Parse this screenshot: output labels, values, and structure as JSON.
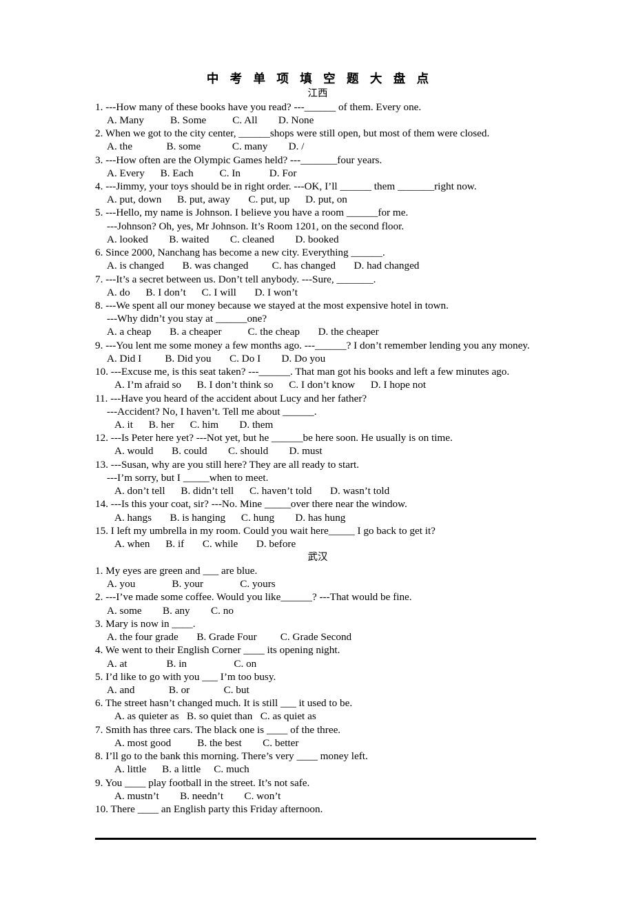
{
  "document": {
    "title": "中 考 单 项 填 空 题 大 盘 点",
    "sections": [
      {
        "name": "江西",
        "questions": [
          {
            "lines": [
              "1. ---How many of these books have you read?    ---______ of them. Every one."
            ],
            "options": "A. Many          B. Some          C. All        D. None",
            "indent": "normal"
          },
          {
            "lines": [
              "2. When we got to the city center, ______shops were still open, but most of them were closed."
            ],
            "options": "A. the             B. some            C. many        D. /",
            "indent": "normal"
          },
          {
            "lines": [
              "3. ---How often are the Olympic Games held?      ---_______four years."
            ],
            "options": "A. Every      B. Each          C. In           D. For",
            "indent": "normal"
          },
          {
            "lines": [
              "4. ---Jimmy, your toys should be in right order.     ---OK, I’ll ______ them _______right now."
            ],
            "options": "A. put, down      B. put, away       C. put, up      D. put, on",
            "indent": "normal"
          },
          {
            "lines": [
              "5. ---Hello, my name is Johnson. I believe you have a room ______for me."
            ],
            "sub": "---Johnson? Oh, yes, Mr Johnson. It’s Room 1201, on the second floor.",
            "options": "A. looked        B. waited        C. cleaned        D. booked",
            "indent": "normal"
          },
          {
            "lines": [
              "6. Since 2000, Nanchang has become a new city. Everything ______."
            ],
            "options": "A. is changed       B. was changed         C. has changed       D. had changed",
            "indent": "normal"
          },
          {
            "lines": [
              "7. ---It’s a secret between us. Don’t tell anybody.       ---Sure, _______."
            ],
            "options": "A. do      B. I don’t      C. I will       D. I won’t",
            "indent": "normal"
          },
          {
            "lines": [
              "8. ---We spent all our money because we stayed at the most expensive hotel in town."
            ],
            "sub": "---Why didn’t you stay at ______one?",
            "options": "A. a cheap       B. a cheaper          C. the cheap       D. the cheaper",
            "indent": "normal"
          },
          {
            "lines": [
              "9. ---You lent me some money a few months ago.   ---______? I don’t remember lending you any money."
            ],
            "options": "A. Did I         B. Did you       C. Do I        D. Do you",
            "indent": "normal"
          },
          {
            "lines": [
              "10. ---Excuse me, is this seat taken?    ---______. That man got his books and left a few minutes ago."
            ],
            "options": "A. I’m afraid so      B. I don’t think so      C. I don’t know      D. I hope not",
            "indent": "deep"
          },
          {
            "lines": [
              "11. ---Have you heard of the accident about Lucy and her father?"
            ],
            "sub": "---Accident? No, I haven’t. Tell me about ______.",
            "options": "A. it      B. her      C. him        D. them",
            "indent": "deep"
          },
          {
            "lines": [
              "12. ---Is Peter here yet?    ---Not yet, but he ______be here soon. He usually is on time."
            ],
            "options": "A. would       B. could        C. should        D. must",
            "indent": "deep"
          },
          {
            "lines": [
              "13. ---Susan, why are you still here? They are all ready to start."
            ],
            "sub": "---I’m sorry, but I _____when to meet.",
            "options": "A. don’t tell      B. didn’t tell      C. haven’t told       D. wasn’t told",
            "indent": "deep"
          },
          {
            "lines": [
              "14. ---Is this your coat, sir?     ---No. Mine _____over there near the window."
            ],
            "options": "A. hangs       B. is hanging      C. hung        D. has hung",
            "indent": "deep"
          },
          {
            "lines": [
              "15. I left my umbrella in my room. Could you wait here_____ I go back to get it?"
            ],
            "options": "A. when      B. if       C. while       D. before",
            "indent": "deep"
          }
        ]
      },
      {
        "name": "武汉",
        "questions": [
          {
            "lines": [
              "1. My eyes are green and ___ are blue."
            ],
            "options": "A. you              B. your              C. yours",
            "indent": "normal"
          },
          {
            "lines": [
              "2. ---I’ve made some coffee. Would you like______?       ---That would be fine."
            ],
            "options": "A. some        B. any        C. no",
            "indent": "normal"
          },
          {
            "lines": [
              "3. Mary is now in ____."
            ],
            "options": "A. the four grade       B. Grade Four         C. Grade Second",
            "indent": "normal"
          },
          {
            "lines": [
              "4. We went to their English Corner ____ its opening night."
            ],
            "options": "A. at               B. in                  C. on",
            "indent": "normal"
          },
          {
            "lines": [
              "5. I’d like to go with you ___ I’m too busy."
            ],
            "options": "A. and             B. or             C. but",
            "indent": "normal"
          },
          {
            "lines": [
              "6. The street hasn’t changed much. It is still  ___ it used to be."
            ],
            "options": "A. as quieter as   B. so quiet than   C. as quiet as",
            "indent": "deep"
          },
          {
            "lines": [
              "7. Smith has three cars. The black one is ____ of the three."
            ],
            "options": "A. most good          B. the best        C. better",
            "indent": "deep"
          },
          {
            "lines": [
              "8. I’ll go to the bank this morning. There’s very ____ money left."
            ],
            "options": "A. little      B. a little     C. much",
            "indent": "deep"
          },
          {
            "lines": [
              "9. You ____ play football in the street. It’s not safe."
            ],
            "options": "A. mustn’t        B. needn’t        C. won’t",
            "indent": "deep"
          },
          {
            "lines": [
              "10. There ____ an English party this Friday afternoon."
            ],
            "options": "",
            "indent": "normal"
          }
        ]
      }
    ]
  }
}
